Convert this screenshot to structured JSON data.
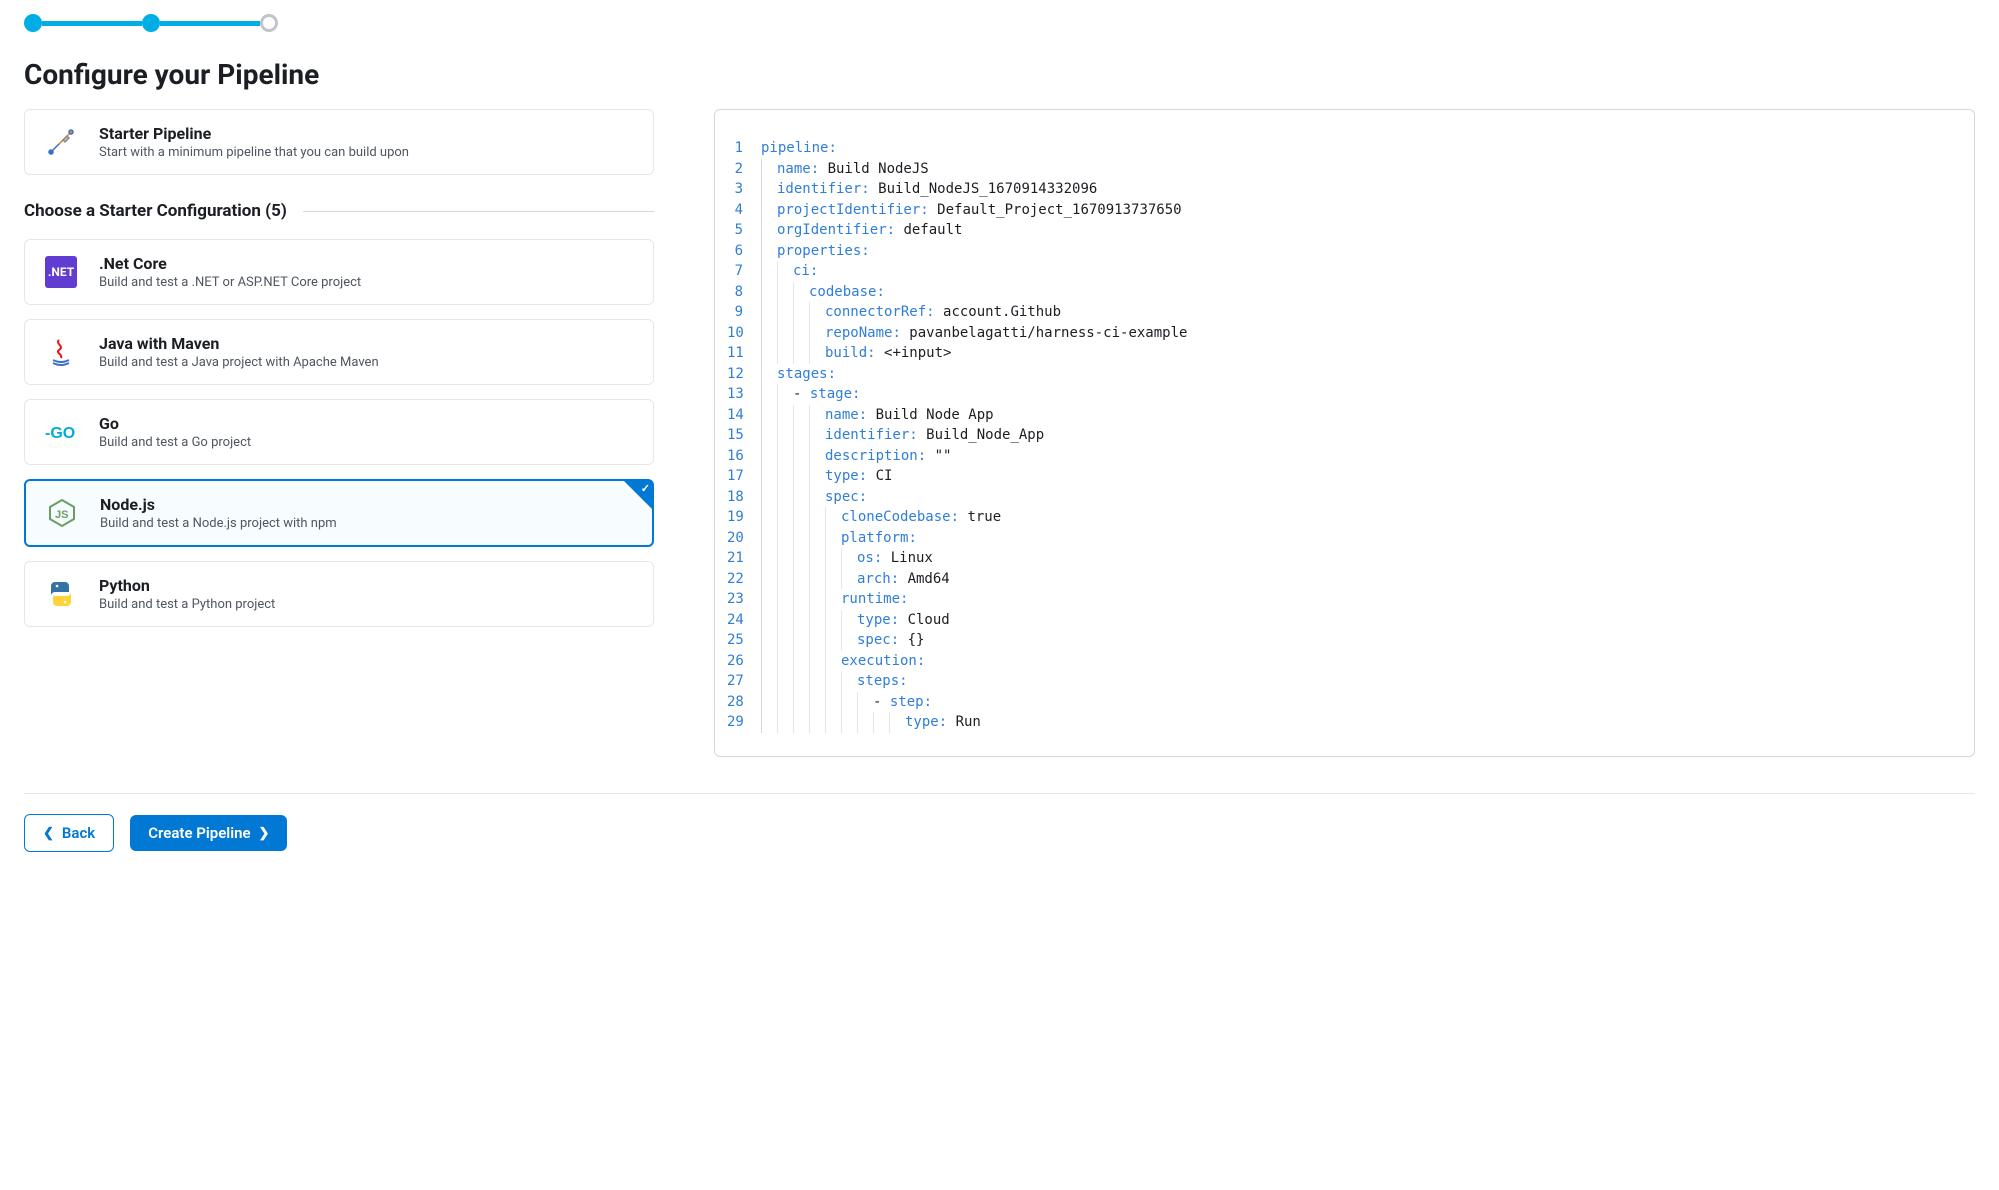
{
  "page_title": "Configure your Pipeline",
  "starter_card": {
    "title": "Starter Pipeline",
    "desc": "Start with a minimum pipeline that you can build upon",
    "icon": "tools-icon"
  },
  "section_header": "Choose a Starter Configuration (5)",
  "configs": [
    {
      "title": ".Net Core",
      "desc": "Build and test a .NET or ASP.NET Core project",
      "icon": "dotnet-icon",
      "icon_text": ".NET",
      "selected": false
    },
    {
      "title": "Java with Maven",
      "desc": "Build and test a Java project with Apache Maven",
      "icon": "java-icon",
      "selected": false
    },
    {
      "title": "Go",
      "desc": "Build and test a Go project",
      "icon": "go-icon",
      "selected": false
    },
    {
      "title": "Node.js",
      "desc": "Build and test a Node.js project with npm",
      "icon": "nodejs-icon",
      "selected": true
    },
    {
      "title": "Python",
      "desc": "Build and test a Python project",
      "icon": "python-icon",
      "selected": false
    }
  ],
  "code": {
    "lines": [
      {
        "n": 1,
        "indent": 0,
        "tokens": [
          [
            "key",
            "pipeline"
          ],
          [
            "punc",
            ":"
          ]
        ]
      },
      {
        "n": 2,
        "indent": 1,
        "tokens": [
          [
            "key",
            "name"
          ],
          [
            "punc",
            ": "
          ],
          [
            "str",
            "Build NodeJS"
          ]
        ]
      },
      {
        "n": 3,
        "indent": 1,
        "tokens": [
          [
            "key",
            "identifier"
          ],
          [
            "punc",
            ": "
          ],
          [
            "str",
            "Build_NodeJS_1670914332096"
          ]
        ]
      },
      {
        "n": 4,
        "indent": 1,
        "tokens": [
          [
            "key",
            "projectIdentifier"
          ],
          [
            "punc",
            ": "
          ],
          [
            "str",
            "Default_Project_1670913737650"
          ]
        ]
      },
      {
        "n": 5,
        "indent": 1,
        "tokens": [
          [
            "key",
            "orgIdentifier"
          ],
          [
            "punc",
            ": "
          ],
          [
            "str",
            "default"
          ]
        ]
      },
      {
        "n": 6,
        "indent": 1,
        "tokens": [
          [
            "key",
            "properties"
          ],
          [
            "punc",
            ":"
          ]
        ]
      },
      {
        "n": 7,
        "indent": 2,
        "tokens": [
          [
            "key",
            "ci"
          ],
          [
            "punc",
            ":"
          ]
        ]
      },
      {
        "n": 8,
        "indent": 3,
        "tokens": [
          [
            "key",
            "codebase"
          ],
          [
            "punc",
            ":"
          ]
        ]
      },
      {
        "n": 9,
        "indent": 4,
        "tokens": [
          [
            "key",
            "connectorRef"
          ],
          [
            "punc",
            ": "
          ],
          [
            "str",
            "account.Github"
          ]
        ]
      },
      {
        "n": 10,
        "indent": 4,
        "tokens": [
          [
            "key",
            "repoName"
          ],
          [
            "punc",
            ": "
          ],
          [
            "str",
            "pavanbelagatti/harness-ci-example"
          ]
        ]
      },
      {
        "n": 11,
        "indent": 4,
        "tokens": [
          [
            "key",
            "build"
          ],
          [
            "punc",
            ": "
          ],
          [
            "str",
            "<+input>"
          ]
        ]
      },
      {
        "n": 12,
        "indent": 1,
        "tokens": [
          [
            "key",
            "stages"
          ],
          [
            "punc",
            ":"
          ]
        ]
      },
      {
        "n": 13,
        "indent": 2,
        "tokens": [
          [
            "str",
            "- "
          ],
          [
            "key",
            "stage"
          ],
          [
            "punc",
            ":"
          ]
        ]
      },
      {
        "n": 14,
        "indent": 4,
        "tokens": [
          [
            "key",
            "name"
          ],
          [
            "punc",
            ": "
          ],
          [
            "str",
            "Build Node App"
          ]
        ]
      },
      {
        "n": 15,
        "indent": 4,
        "tokens": [
          [
            "key",
            "identifier"
          ],
          [
            "punc",
            ": "
          ],
          [
            "str",
            "Build_Node_App"
          ]
        ]
      },
      {
        "n": 16,
        "indent": 4,
        "tokens": [
          [
            "key",
            "description"
          ],
          [
            "punc",
            ": "
          ],
          [
            "str",
            "\"\""
          ]
        ]
      },
      {
        "n": 17,
        "indent": 4,
        "tokens": [
          [
            "key",
            "type"
          ],
          [
            "punc",
            ": "
          ],
          [
            "str",
            "CI"
          ]
        ]
      },
      {
        "n": 18,
        "indent": 4,
        "tokens": [
          [
            "key",
            "spec"
          ],
          [
            "punc",
            ":"
          ]
        ]
      },
      {
        "n": 19,
        "indent": 5,
        "tokens": [
          [
            "key",
            "cloneCodebase"
          ],
          [
            "punc",
            ": "
          ],
          [
            "str",
            "true"
          ]
        ]
      },
      {
        "n": 20,
        "indent": 5,
        "tokens": [
          [
            "key",
            "platform"
          ],
          [
            "punc",
            ":"
          ]
        ]
      },
      {
        "n": 21,
        "indent": 6,
        "tokens": [
          [
            "key",
            "os"
          ],
          [
            "punc",
            ": "
          ],
          [
            "str",
            "Linux"
          ]
        ]
      },
      {
        "n": 22,
        "indent": 6,
        "tokens": [
          [
            "key",
            "arch"
          ],
          [
            "punc",
            ": "
          ],
          [
            "str",
            "Amd64"
          ]
        ]
      },
      {
        "n": 23,
        "indent": 5,
        "tokens": [
          [
            "key",
            "runtime"
          ],
          [
            "punc",
            ":"
          ]
        ]
      },
      {
        "n": 24,
        "indent": 6,
        "tokens": [
          [
            "key",
            "type"
          ],
          [
            "punc",
            ": "
          ],
          [
            "str",
            "Cloud"
          ]
        ]
      },
      {
        "n": 25,
        "indent": 6,
        "tokens": [
          [
            "key",
            "spec"
          ],
          [
            "punc",
            ": "
          ],
          [
            "str",
            "{}"
          ]
        ]
      },
      {
        "n": 26,
        "indent": 5,
        "tokens": [
          [
            "key",
            "execution"
          ],
          [
            "punc",
            ":"
          ]
        ]
      },
      {
        "n": 27,
        "indent": 6,
        "tokens": [
          [
            "key",
            "steps"
          ],
          [
            "punc",
            ":"
          ]
        ]
      },
      {
        "n": 28,
        "indent": 7,
        "tokens": [
          [
            "str",
            "- "
          ],
          [
            "key",
            "step"
          ],
          [
            "punc",
            ":"
          ]
        ]
      },
      {
        "n": 29,
        "indent": 9,
        "tokens": [
          [
            "key",
            "type"
          ],
          [
            "punc",
            ": "
          ],
          [
            "str",
            "Run"
          ]
        ]
      }
    ]
  },
  "footer": {
    "back_label": "Back",
    "create_label": "Create Pipeline"
  }
}
